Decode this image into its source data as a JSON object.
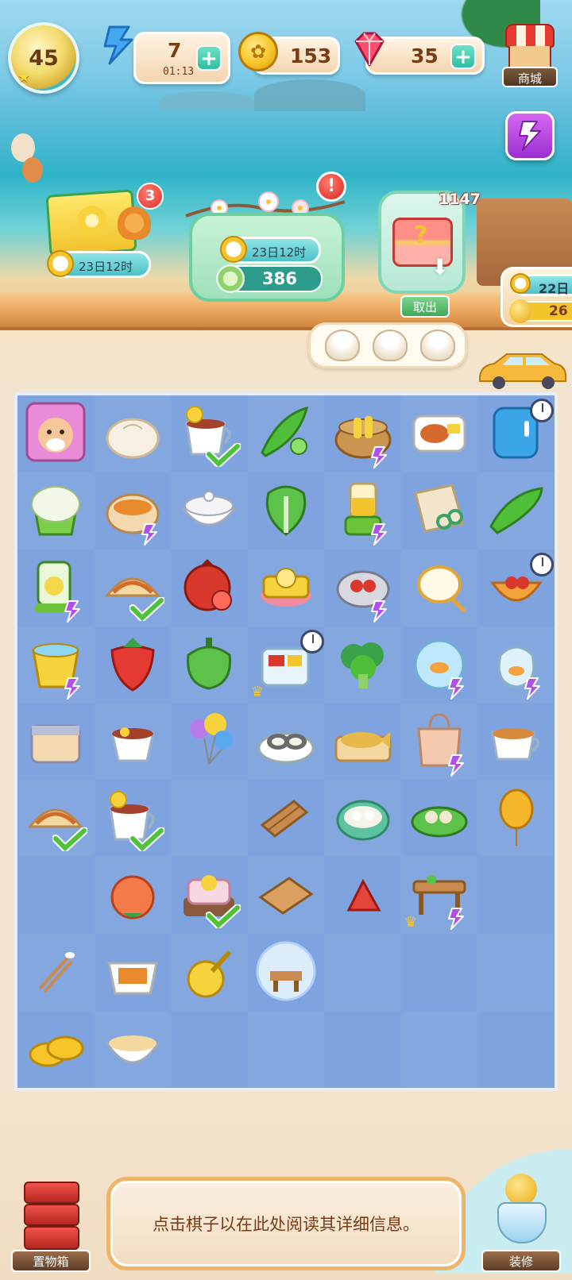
{
  "hud": {
    "level": "45",
    "energy": {
      "value": "7",
      "timer": "01:13",
      "plus": "+"
    },
    "coins": {
      "value": "153"
    },
    "gems": {
      "value": "35",
      "plus": "+"
    },
    "shop_label": "商城"
  },
  "events": {
    "gift_pack": {
      "badge": "3",
      "timer": "23日12时"
    },
    "blossom": {
      "alert": "!",
      "timer": "23日12时",
      "tea_count": "386"
    },
    "chest": {
      "count": "1147",
      "take_label": "取出"
    },
    "side": {
      "timer": "22日",
      "value": "26"
    }
  },
  "order": {
    "items": [
      "steamed-bun",
      "steamed-bun",
      "steamed-bun"
    ]
  },
  "board": {
    "rows": [
      [
        "hamster-card",
        "steamed-bun",
        "lemon-tea-cup",
        "okra",
        "corn-basket",
        "meal-box",
        "blue-fridge"
      ],
      [
        "juicer",
        "soup-pot",
        "rice-bowl",
        "bok-choy",
        "juice-blender",
        "paper-scissors",
        "cucumber"
      ],
      [
        "green-blender",
        "taco",
        "pomegranate",
        "pineapple-cake",
        "cherry-pan",
        "fishing-net",
        "cherry-bowl"
      ],
      [
        "water-bucket",
        "strawberry",
        "green-pepper",
        "lunch-cooler",
        "broccoli",
        "fishbowl",
        "fish-bag"
      ],
      [
        "storage-box",
        "lemon-tea",
        "balloons",
        "oyster-plate",
        "fish-plate",
        "paper-bag",
        "tea-cup"
      ],
      [
        "taco",
        "lemon-tea-cup",
        "",
        "wood-planks",
        "dumpling-bowl",
        "shrimp-leaf",
        "yellow-balloon"
      ],
      [
        "",
        "peach",
        "flower-cake",
        "wood-board",
        "red-shard",
        "table-set",
        ""
      ],
      [
        "cotton-swab",
        "takeout-box",
        "coin-roller",
        "bubble-table",
        "",
        "",
        ""
      ],
      [
        "gold-coins",
        "pudding-bowl",
        "",
        "",
        "",
        "",
        ""
      ]
    ]
  },
  "bottom": {
    "storage_label": "置物箱",
    "info_text": "点击棋子以在此处阅读其详细信息。",
    "decor_label": "装修"
  },
  "colors": {
    "board_bg": "#7fa3df",
    "accent_teal": "#2fbfa2",
    "text_brown": "#7a3c14",
    "badge_red": "#e0302a"
  }
}
